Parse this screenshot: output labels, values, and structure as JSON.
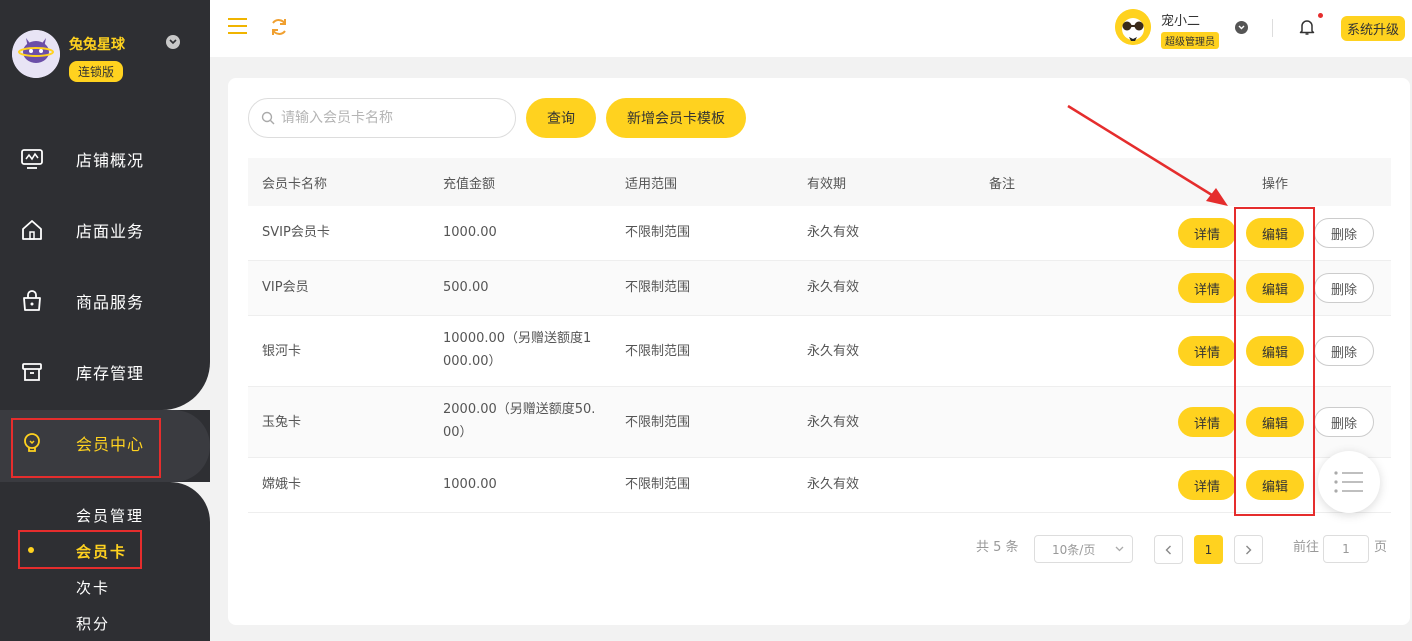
{
  "brand": {
    "name": "兔兔星球",
    "edition": "连锁版"
  },
  "nav": [
    {
      "label": "店铺概况",
      "icon": "monitor-icon"
    },
    {
      "label": "店面业务",
      "icon": "home-icon"
    },
    {
      "label": "商品服务",
      "icon": "bag-icon"
    },
    {
      "label": "库存管理",
      "icon": "box-icon"
    },
    {
      "label": "会员中心",
      "icon": "bulb-icon",
      "active": true
    }
  ],
  "subnav": [
    {
      "label": "会员管理"
    },
    {
      "label": "会员卡",
      "active": true
    },
    {
      "label": "次卡"
    },
    {
      "label": "积分"
    }
  ],
  "header": {
    "user_name": "宠小二",
    "user_role": "超级管理员",
    "upgrade": "系统升级"
  },
  "search": {
    "placeholder": "请输入会员卡名称"
  },
  "toolbar": {
    "query": "查询",
    "add": "新增会员卡模板"
  },
  "table": {
    "columns": [
      "会员卡名称",
      "充值金额",
      "适用范围",
      "有效期",
      "备注",
      "操作"
    ],
    "rows": [
      {
        "name": "SVIP会员卡",
        "amount": [
          "1000.00"
        ],
        "scope": "不限制范围",
        "validity": "永久有效",
        "note": "",
        "can_delete": true
      },
      {
        "name": "VIP会员",
        "amount": [
          "500.00"
        ],
        "scope": "不限制范围",
        "validity": "永久有效",
        "note": "",
        "can_delete": true
      },
      {
        "name": "银河卡",
        "amount": [
          "10000.00（另赠送额度1",
          "000.00）"
        ],
        "scope": "不限制范围",
        "validity": "永久有效",
        "note": "",
        "can_delete": true
      },
      {
        "name": "玉兔卡",
        "amount": [
          "2000.00（另赠送额度50.",
          "00）"
        ],
        "scope": "不限制范围",
        "validity": "永久有效",
        "note": "",
        "can_delete": true
      },
      {
        "name": "嫦娥卡",
        "amount": [
          "1000.00"
        ],
        "scope": "不限制范围",
        "validity": "永久有效",
        "note": "",
        "can_delete": false
      }
    ],
    "actions": {
      "detail": "详情",
      "edit": "编辑",
      "delete": "删除"
    }
  },
  "pagination": {
    "total": "共 5 条",
    "page_size": "10条/页",
    "current": "1",
    "goto_label": "前往",
    "goto_value": "1",
    "page_suffix": "页"
  },
  "colors": {
    "accent": "#ffd21f",
    "sidebar": "#2e2f33",
    "highlight_box": "#e52d2d"
  }
}
